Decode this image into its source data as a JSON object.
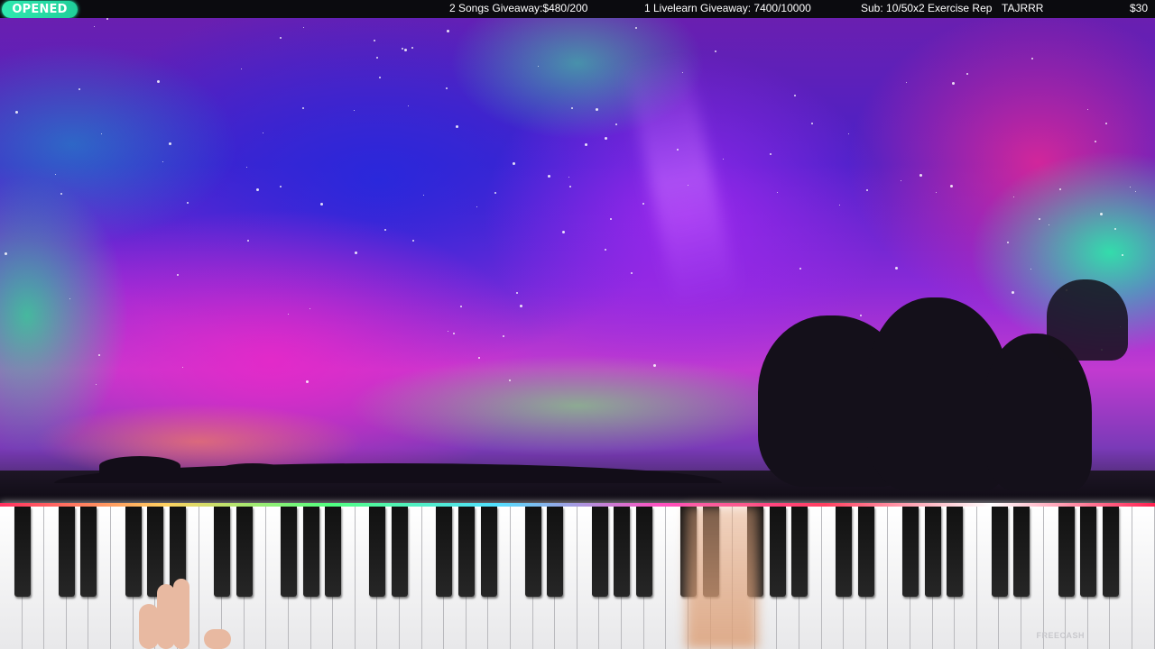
{
  "status_pill": {
    "label": "OPENED"
  },
  "ticker": {
    "songs_giveaway": "2 Songs Giveaway:$480/200",
    "livelearn_giveaway": "1 Livelearn Giveaway: 7400/10000",
    "sub_goal": "Sub: 10/50x2 Exercise Rep",
    "username": "TAJRRR",
    "amount": "$30"
  },
  "watermark": "FREECASH",
  "colors": {
    "pill_accent": "#2fe9b0",
    "topbar_bg": "#0b0b0f"
  }
}
